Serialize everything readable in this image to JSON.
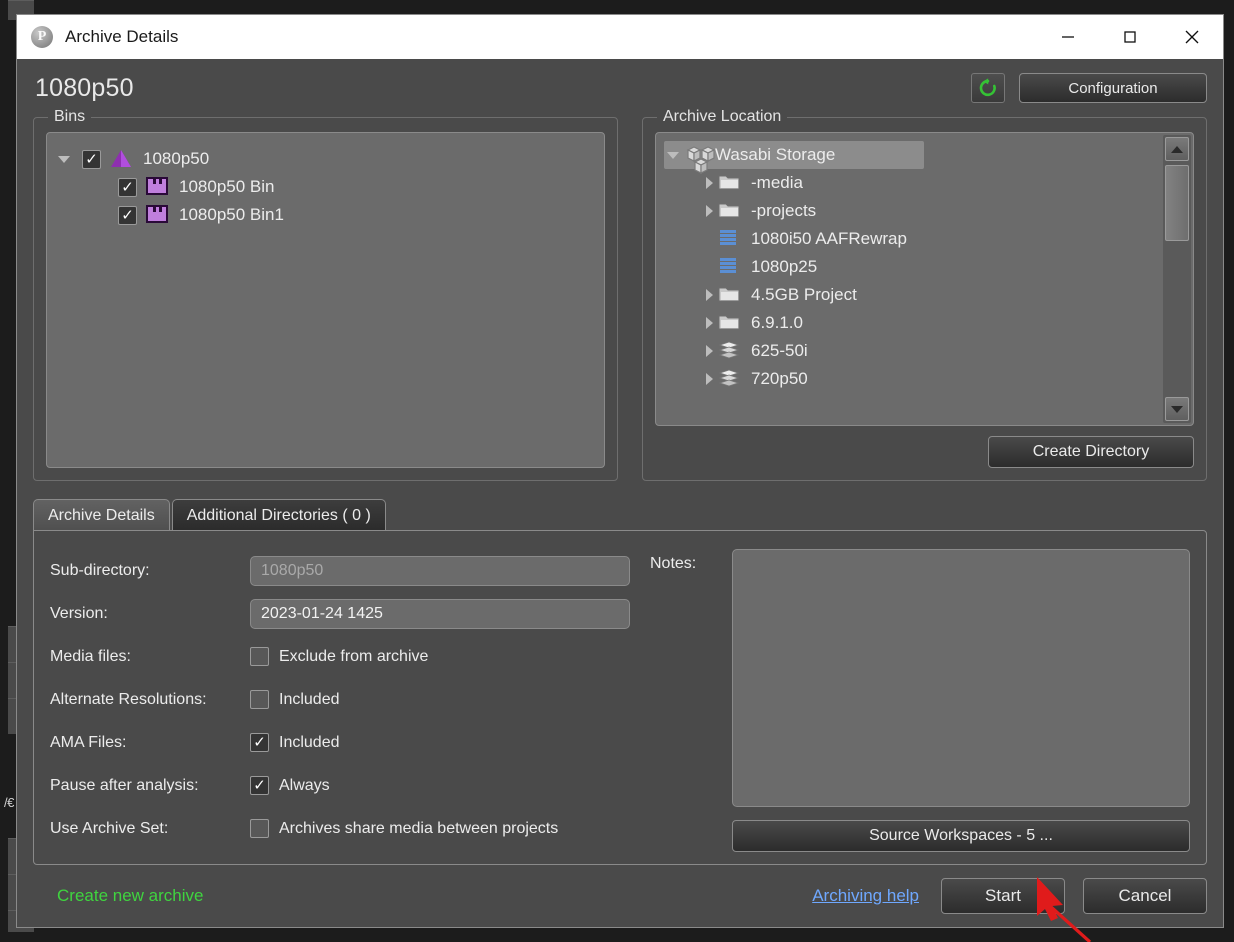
{
  "window": {
    "title": "Archive Details",
    "app_icon": "avid-p-icon",
    "minimize": "—",
    "maximize": "□",
    "close": "✕"
  },
  "header": {
    "title": "1080p50",
    "refresh_icon": "refresh-icon",
    "configuration_label": "Configuration",
    "refresh_color": "#35c235"
  },
  "bins": {
    "legend": "Bins",
    "items": [
      {
        "label": "1080p50",
        "icon": "project-triangle-icon",
        "checked": true,
        "twisty": "open",
        "depth": 0
      },
      {
        "label": "1080p50 Bin",
        "icon": "bin-icon",
        "checked": true,
        "twisty": "blank",
        "depth": 1
      },
      {
        "label": "1080p50 Bin1",
        "icon": "bin-icon",
        "checked": true,
        "twisty": "blank",
        "depth": 1
      }
    ]
  },
  "archive_location": {
    "legend": "Archive Location",
    "items": [
      {
        "label": "Wasabi Storage",
        "icon": "cube-storage-icon",
        "twisty": "open",
        "depth": 0,
        "selected": true
      },
      {
        "label": "-media",
        "icon": "folder-icon",
        "twisty": "closed",
        "depth": 1,
        "selected": false
      },
      {
        "label": "-projects",
        "icon": "folder-icon",
        "twisty": "closed",
        "depth": 1,
        "selected": false
      },
      {
        "label": "1080i50 AAFRewrap",
        "icon": "archive-bars-icon",
        "twisty": "blank",
        "depth": 1,
        "selected": false
      },
      {
        "label": "1080p25",
        "icon": "archive-bars-icon",
        "twisty": "blank",
        "depth": 1,
        "selected": false
      },
      {
        "label": "4.5GB Project",
        "icon": "folder-icon",
        "twisty": "closed",
        "depth": 1,
        "selected": false
      },
      {
        "label": "6.9.1.0",
        "icon": "folder-icon",
        "twisty": "closed",
        "depth": 1,
        "selected": false
      },
      {
        "label": "625-50i",
        "icon": "stack-layers-icon",
        "twisty": "closed",
        "depth": 1,
        "selected": false
      },
      {
        "label": "720p50",
        "icon": "stack-layers-icon",
        "twisty": "closed",
        "depth": 1,
        "selected": false
      }
    ],
    "create_directory_label": "Create Directory",
    "scroll_up_icon": "scroll-up-arrow-icon",
    "scroll_down_icon": "scroll-down-arrow-icon"
  },
  "tabs": [
    {
      "label": "Archive Details",
      "active": true
    },
    {
      "label": "Additional Directories ( 0 )",
      "active": false
    }
  ],
  "form": {
    "subdirectory": {
      "label": "Sub-directory:",
      "value": "1080p50",
      "is_placeholder": true
    },
    "version": {
      "label": "Version:",
      "value": "2023-01-24 1425",
      "is_placeholder": false
    },
    "checkrows": [
      {
        "label": "Media files:",
        "text": "Exclude from archive",
        "checked": false
      },
      {
        "label": "Alternate Resolutions:",
        "text": "Included",
        "checked": false
      },
      {
        "label": "AMA Files:",
        "text": "Included",
        "checked": true
      },
      {
        "label": "Pause after analysis:",
        "text": "Always",
        "checked": true
      },
      {
        "label": "Use Archive Set:",
        "text": "Archives share media between projects",
        "checked": false
      }
    ]
  },
  "notes": {
    "label": "Notes:",
    "value": "",
    "workspaces_label": "Source Workspaces - 5 ..."
  },
  "footer": {
    "status": "Create new archive",
    "status_color": "#3fd43f",
    "help_label": "Archiving help",
    "start_label": "Start",
    "cancel_label": "Cancel"
  },
  "background": {
    "edge_text": "/€"
  }
}
